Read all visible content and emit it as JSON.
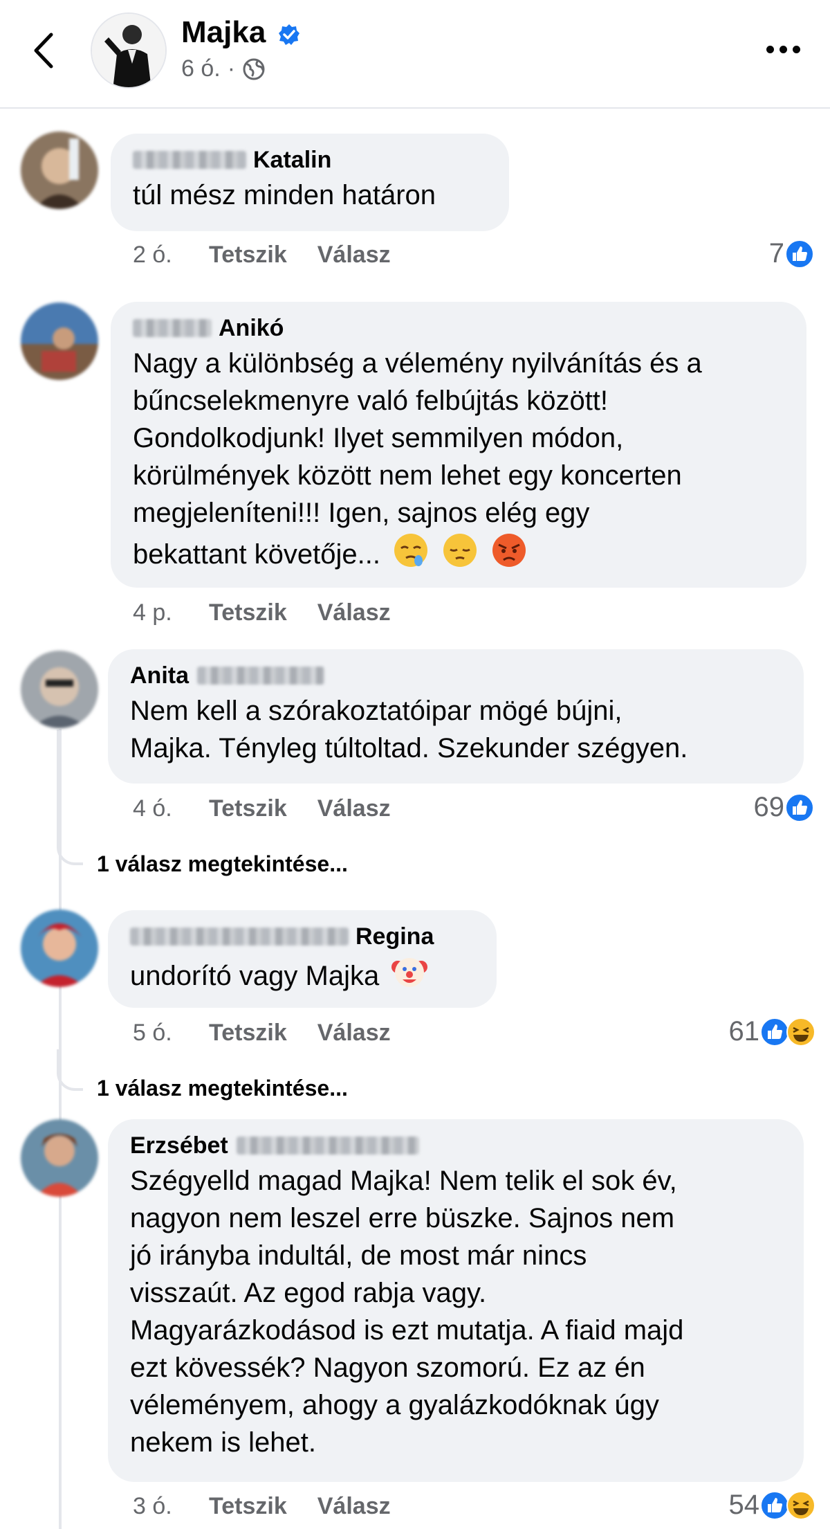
{
  "header": {
    "name": "Majka",
    "time": "6 ó.",
    "separator": "·",
    "icons": {
      "back": "chevron-left-icon",
      "verified": "verified-badge-icon",
      "audience": "globe-icon",
      "more": "more-dots-icon"
    }
  },
  "actions": {
    "like": "Tetszik",
    "reply": "Válasz"
  },
  "colors": {
    "accent": "#1877f2",
    "bubble": "#f0f2f5",
    "meta": "#65676b",
    "haha": "#f7b928"
  },
  "comments": [
    {
      "name": "Katalin",
      "lines": [
        "túl mész minden határon"
      ],
      "time": "2 ó.",
      "reactions": "7",
      "reaction_icons": [
        "like-icon"
      ]
    },
    {
      "name": "Anikó",
      "lines": [
        "Nagy a különbség a vélemény nyilvánítás és a",
        "bűncselekmenyre való felbújtás között!",
        "Gondolkodjunk! Ilyet semmilyen módon,",
        "körülmények között nem lehet egy koncerten",
        "megjeleníteni!!! Igen, sajnos elég egy",
        "bekattant követője..."
      ],
      "emojis": [
        "sleepy-face-icon",
        "pensive-face-icon",
        "angry-face-icon"
      ],
      "time": "4 p."
    },
    {
      "name": "Anita",
      "lines": [
        "Nem kell a szórakoztatóipar mögé bújni,",
        "Majka. Tényleg túltoltad. Szekunder szégyen."
      ],
      "time": "4 ó.",
      "reactions": "69",
      "reaction_icons": [
        "like-icon"
      ],
      "view_replies": "1 válasz megtekintése..."
    },
    {
      "name": "Regina",
      "lines": [
        "undorító vagy Majka"
      ],
      "emojis": [
        "clown-face-icon"
      ],
      "time": "5 ó.",
      "reactions": "61",
      "reaction_icons": [
        "like-icon",
        "haha-icon"
      ],
      "view_replies": "1 válasz megtekintése..."
    },
    {
      "name": "Erzsébet",
      "lines": [
        "Szégyelld magad Majka! Nem telik el sok év,",
        "nagyon nem leszel erre büszke. Sajnos nem",
        "jó irányba indultál, de most már nincs",
        "visszaút. Az egod rabja vagy.",
        "Magyarázkodásod is ezt mutatja. A fiaid majd",
        "ezt kövessék? Nagyon szomorú. Ez az én",
        "véleményem, ahogy a gyalázkodóknak úgy",
        "nekem is lehet."
      ],
      "time": "3 ó.",
      "reactions": "54",
      "reaction_icons": [
        "like-icon",
        "haha-icon"
      ]
    }
  ]
}
